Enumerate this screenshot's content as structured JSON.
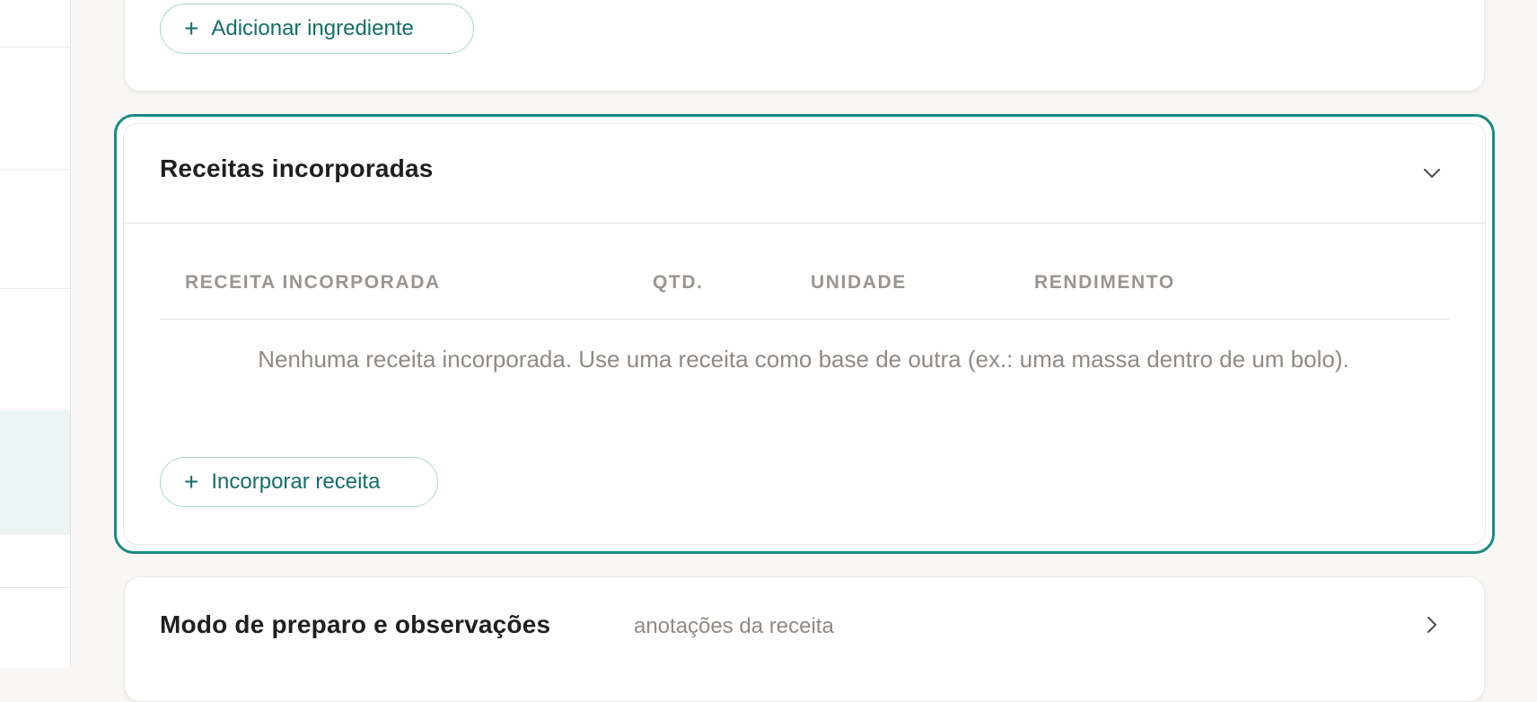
{
  "ingredients_card": {
    "add_button_label": "Adicionar ingrediente",
    "add_icon": "+"
  },
  "incorporated_recipes": {
    "title": "Receitas incorporadas",
    "toggle_icon": "chevron-down-icon",
    "columns": [
      "RECEITA INCORPORADA",
      "QTD.",
      "UNIDADE",
      "RENDIMENTO"
    ],
    "empty_message": "Nenhuma receita incorporada. Use uma receita como base de outra (ex.: uma massa dentro de um bolo).",
    "add_button_label": "Incorporar receita",
    "add_icon": "+"
  },
  "preparation_card": {
    "title": "Modo de preparo e observações",
    "subtitle": "anotações da receita",
    "toggle_icon": "chevron-right-icon"
  },
  "colors": {
    "accent": "#1a8a84",
    "accent_text": "#146e69",
    "active_row_bg": "#eaf5f4"
  }
}
